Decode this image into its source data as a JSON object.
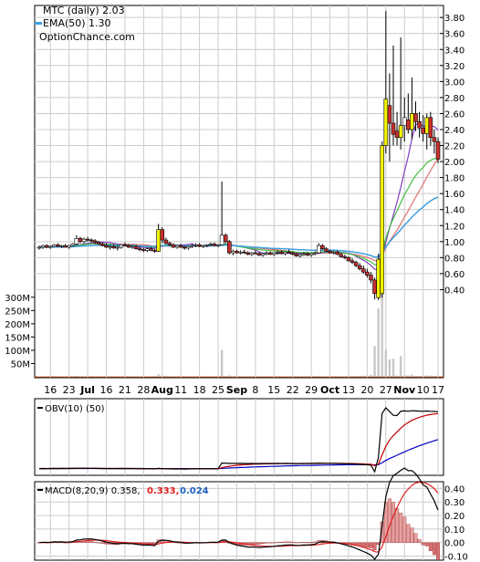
{
  "chart_data": [
    {
      "type": "candlestick",
      "panel": "price",
      "legend": [
        "MTC (daily) 2.03",
        "EMA(50) 1.30",
        "OptionChance.com"
      ],
      "y_ticks": [
        "3.80",
        "3.60",
        "3.40",
        "3.20",
        "3.00",
        "2.80",
        "2.60",
        "2.40",
        "2.20",
        "2.00",
        "1.80",
        "1.60",
        "1.40",
        "1.20",
        "1.00",
        "0.80",
        "0.60",
        "0.40"
      ],
      "ylim": [
        0.2,
        3.95
      ],
      "volume_ticks": [
        "300M",
        "250M",
        "200M",
        "150M",
        "100M",
        "50M"
      ],
      "volume_lim": [
        0,
        320
      ],
      "x_ticks": [
        "16",
        "23",
        "Jul",
        "16",
        "21",
        "28",
        "Aug",
        "11",
        "18",
        "25",
        "Sep",
        "8",
        "15",
        "22",
        "29",
        "Oct",
        "13",
        "20",
        "27",
        "Nov",
        "10",
        "17"
      ],
      "day_count": 108,
      "ohlc": [
        [
          0.92,
          0.95,
          0.9,
          0.93
        ],
        [
          0.93,
          0.96,
          0.91,
          0.95
        ],
        [
          0.95,
          0.97,
          0.92,
          0.93
        ],
        [
          0.93,
          0.95,
          0.91,
          0.94
        ],
        [
          0.94,
          0.97,
          0.93,
          0.96
        ],
        [
          0.96,
          0.98,
          0.93,
          0.94
        ],
        [
          0.94,
          0.96,
          0.92,
          0.95
        ],
        [
          0.95,
          0.97,
          0.93,
          0.93
        ],
        [
          0.93,
          0.96,
          0.91,
          0.95
        ],
        [
          0.95,
          0.98,
          0.94,
          0.97
        ],
        [
          0.97,
          1.08,
          0.95,
          1.04
        ],
        [
          1.04,
          1.06,
          0.98,
          1.0
        ],
        [
          1.0,
          1.05,
          0.98,
          1.03
        ],
        [
          1.03,
          1.06,
          1.0,
          1.02
        ],
        [
          1.02,
          1.04,
          0.99,
          1.01
        ],
        [
          1.01,
          1.03,
          0.97,
          0.99
        ],
        [
          0.99,
          1.01,
          0.96,
          0.97
        ],
        [
          0.97,
          0.99,
          0.94,
          0.95
        ],
        [
          0.95,
          0.98,
          0.92,
          0.93
        ],
        [
          0.93,
          0.96,
          0.9,
          0.94
        ],
        [
          0.94,
          0.96,
          0.91,
          0.92
        ],
        [
          0.92,
          0.95,
          0.89,
          0.93
        ],
        [
          0.93,
          0.97,
          0.91,
          0.96
        ],
        [
          0.96,
          0.99,
          0.94,
          0.95
        ],
        [
          0.95,
          0.97,
          0.92,
          0.93
        ],
        [
          0.93,
          0.96,
          0.91,
          0.94
        ],
        [
          0.94,
          0.96,
          0.9,
          0.91
        ],
        [
          0.91,
          0.94,
          0.88,
          0.9
        ],
        [
          0.9,
          0.92,
          0.87,
          0.89
        ],
        [
          0.89,
          0.92,
          0.87,
          0.91
        ],
        [
          0.91,
          0.93,
          0.88,
          0.89
        ],
        [
          0.89,
          0.91,
          0.86,
          0.88
        ],
        [
          0.88,
          1.22,
          0.87,
          1.15
        ],
        [
          1.15,
          1.18,
          0.98,
          1.02
        ],
        [
          1.02,
          1.05,
          0.96,
          0.98
        ],
        [
          0.98,
          1.0,
          0.94,
          0.96
        ],
        [
          0.96,
          0.98,
          0.92,
          0.93
        ],
        [
          0.93,
          0.96,
          0.91,
          0.95
        ],
        [
          0.95,
          0.97,
          0.92,
          0.93
        ],
        [
          0.93,
          0.95,
          0.9,
          0.92
        ],
        [
          0.92,
          0.95,
          0.9,
          0.94
        ],
        [
          0.94,
          0.97,
          0.92,
          0.95
        ],
        [
          0.95,
          0.98,
          0.93,
          0.96
        ],
        [
          0.96,
          0.98,
          0.93,
          0.94
        ],
        [
          0.94,
          0.96,
          0.92,
          0.95
        ],
        [
          0.95,
          0.97,
          0.93,
          0.96
        ],
        [
          0.96,
          0.99,
          0.94,
          0.97
        ],
        [
          0.97,
          0.99,
          0.94,
          0.95
        ],
        [
          0.95,
          0.97,
          0.93,
          0.96
        ],
        [
          0.96,
          1.75,
          0.95,
          1.08
        ],
        [
          1.08,
          1.1,
          0.98,
          1.0
        ],
        [
          1.0,
          1.02,
          0.84,
          0.86
        ],
        [
          0.86,
          0.9,
          0.83,
          0.88
        ],
        [
          0.88,
          0.9,
          0.85,
          0.86
        ],
        [
          0.86,
          0.89,
          0.84,
          0.87
        ],
        [
          0.87,
          0.9,
          0.85,
          0.86
        ],
        [
          0.86,
          0.88,
          0.83,
          0.84
        ],
        [
          0.84,
          0.87,
          0.82,
          0.86
        ],
        [
          0.86,
          0.89,
          0.84,
          0.85
        ],
        [
          0.85,
          0.87,
          0.82,
          0.83
        ],
        [
          0.83,
          0.86,
          0.81,
          0.85
        ],
        [
          0.85,
          0.88,
          0.83,
          0.86
        ],
        [
          0.86,
          0.88,
          0.83,
          0.84
        ],
        [
          0.84,
          0.87,
          0.82,
          0.86
        ],
        [
          0.86,
          0.89,
          0.84,
          0.87
        ],
        [
          0.87,
          0.89,
          0.84,
          0.85
        ],
        [
          0.85,
          0.88,
          0.83,
          0.87
        ],
        [
          0.87,
          0.9,
          0.85,
          0.86
        ],
        [
          0.86,
          0.88,
          0.83,
          0.84
        ],
        [
          0.84,
          0.86,
          0.81,
          0.82
        ],
        [
          0.82,
          0.85,
          0.8,
          0.84
        ],
        [
          0.84,
          0.87,
          0.82,
          0.85
        ],
        [
          0.85,
          0.87,
          0.82,
          0.83
        ],
        [
          0.83,
          0.86,
          0.81,
          0.85
        ],
        [
          0.85,
          0.88,
          0.83,
          0.86
        ],
        [
          0.86,
          0.98,
          0.85,
          0.95
        ],
        [
          0.95,
          0.97,
          0.9,
          0.91
        ],
        [
          0.91,
          0.93,
          0.87,
          0.88
        ],
        [
          0.88,
          0.9,
          0.85,
          0.86
        ],
        [
          0.86,
          0.89,
          0.84,
          0.87
        ],
        [
          0.87,
          0.89,
          0.83,
          0.84
        ],
        [
          0.84,
          0.86,
          0.8,
          0.81
        ],
        [
          0.81,
          0.84,
          0.78,
          0.8
        ],
        [
          0.8,
          0.82,
          0.75,
          0.76
        ],
        [
          0.76,
          0.79,
          0.72,
          0.74
        ],
        [
          0.74,
          0.76,
          0.68,
          0.7
        ],
        [
          0.7,
          0.73,
          0.64,
          0.66
        ],
        [
          0.66,
          0.7,
          0.6,
          0.62
        ],
        [
          0.62,
          0.66,
          0.55,
          0.58
        ],
        [
          0.58,
          0.62,
          0.48,
          0.52
        ],
        [
          0.52,
          0.55,
          0.28,
          0.35
        ],
        [
          0.3,
          0.85,
          0.27,
          0.78
        ],
        [
          0.35,
          2.25,
          0.3,
          2.2
        ],
        [
          2.2,
          3.88,
          2.1,
          2.78
        ],
        [
          2.7,
          3.1,
          2.0,
          2.48
        ],
        [
          2.48,
          3.45,
          2.2,
          2.34
        ],
        [
          2.38,
          2.62,
          2.2,
          2.3
        ],
        [
          2.3,
          3.55,
          2.15,
          2.45
        ],
        [
          2.45,
          2.8,
          2.25,
          2.55
        ],
        [
          2.52,
          2.85,
          2.35,
          2.4
        ],
        [
          2.4,
          3.05,
          2.28,
          2.6
        ],
        [
          2.6,
          2.75,
          2.38,
          2.5
        ],
        [
          2.5,
          2.62,
          2.3,
          2.42
        ],
        [
          2.42,
          2.58,
          2.25,
          2.35
        ],
        [
          2.35,
          2.6,
          2.15,
          2.55
        ],
        [
          2.55,
          2.62,
          2.2,
          2.3
        ],
        [
          2.3,
          2.4,
          2.1,
          2.25
        ],
        [
          2.25,
          2.3,
          1.98,
          2.03
        ]
      ]
    },
    {
      "type": "line",
      "panel": "obv",
      "legend": [
        "OBV(10) (50)"
      ]
    },
    {
      "type": "macd",
      "panel": "macd",
      "legend": [
        "MACD(8,20,9) 0.358,",
        "0.333,",
        "0.024"
      ],
      "y_ticks": [
        "0.40",
        "0.30",
        "0.20",
        "0.10",
        "0.00",
        "-0.10"
      ],
      "ylim": [
        -0.13,
        0.45
      ]
    }
  ],
  "colors": {
    "up": "#f4f400",
    "down": "#c83030",
    "dark_up": "#d8a0d8",
    "ema": "#40a0e0",
    "ma_a": "#40c040",
    "ma_b": "#8040c0",
    "ma_c": "#e07070",
    "volume": "#e06020",
    "obv_fast": "#c00000",
    "obv_slow": "#0000c0",
    "macd_signal": "#e02020",
    "macd_value": "#2060c0",
    "grid": "#cccccc"
  }
}
